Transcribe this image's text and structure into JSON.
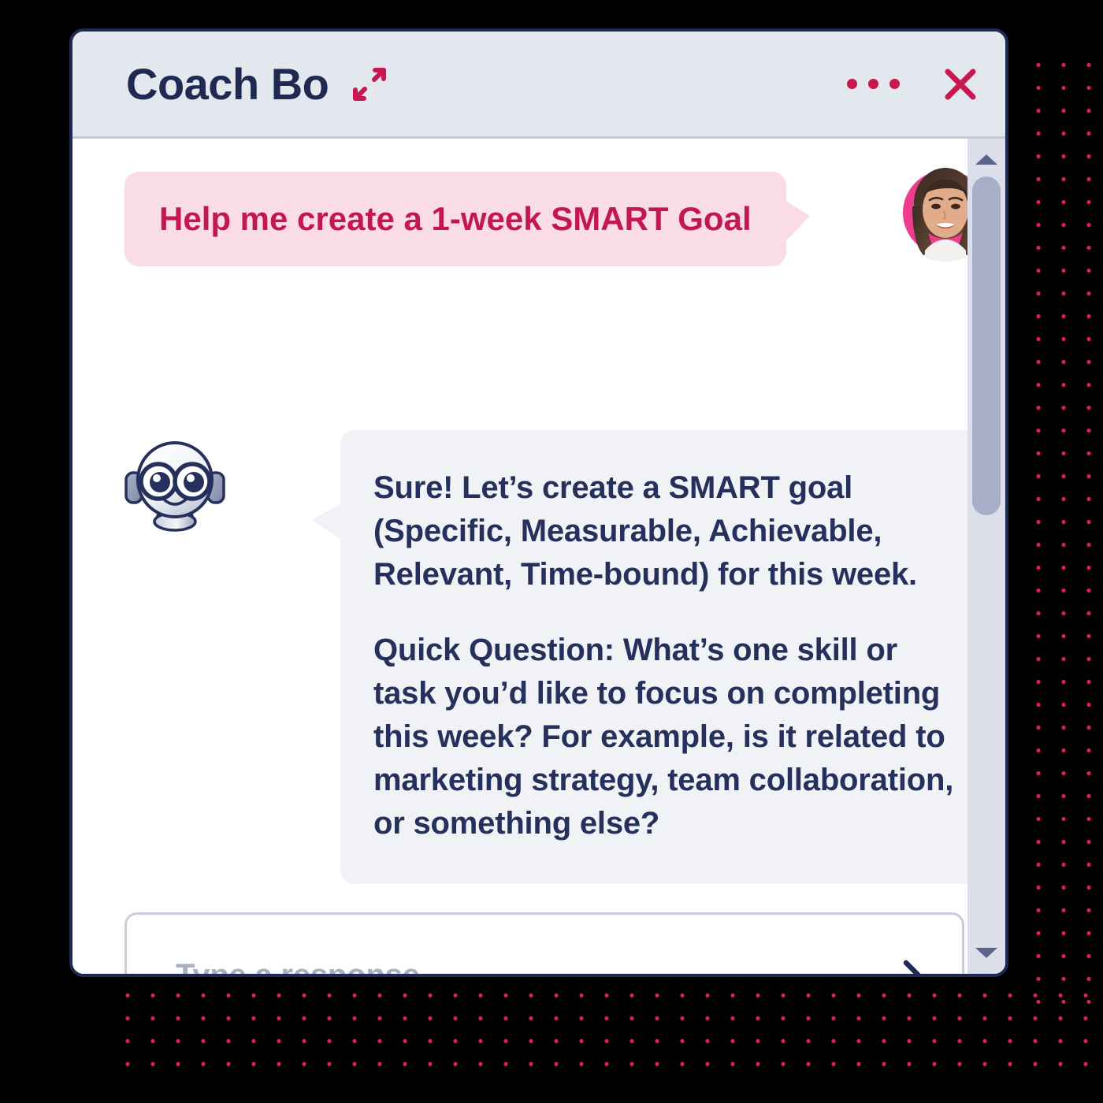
{
  "header": {
    "title": "Coach Bo",
    "expand_icon": "expand-diagonal-arrows-icon",
    "menu_icon": "more-horizontal-dots-icon",
    "close_icon": "close-x-icon"
  },
  "conversation": [
    {
      "role": "user",
      "text": "Help me create a 1-week SMART Goal",
      "avatar": "user-photo-avatar"
    },
    {
      "role": "assistant",
      "avatar": "robot-bot-avatar",
      "paragraphs": [
        "Sure! Let’s create a SMART goal (Specific, Measurable, Achievable, Relevant, Time-bound) for this week.",
        "Quick Question: What’s one skill or task you’d like to focus on completing this week? For example, is it related to marketing strategy, team collaboration, or something else?"
      ]
    }
  ],
  "input": {
    "placeholder": "Type a response...",
    "value": "",
    "send_icon": "chevron-right-icon"
  },
  "scrollbar": {
    "up_icon": "triangle-up-icon",
    "down_icon": "triangle-down-icon"
  },
  "colors": {
    "accent_crimson": "#c9174f",
    "user_bubble_bg": "#fadde4",
    "user_text": "#c3174f",
    "bot_bubble_bg": "#f0f2f6",
    "navy_text": "#25305c",
    "card_border": "#1e2a52",
    "header_bg": "#e3e7ee",
    "dot_pattern": "#e01f58",
    "placeholder": "#a9aec4"
  }
}
